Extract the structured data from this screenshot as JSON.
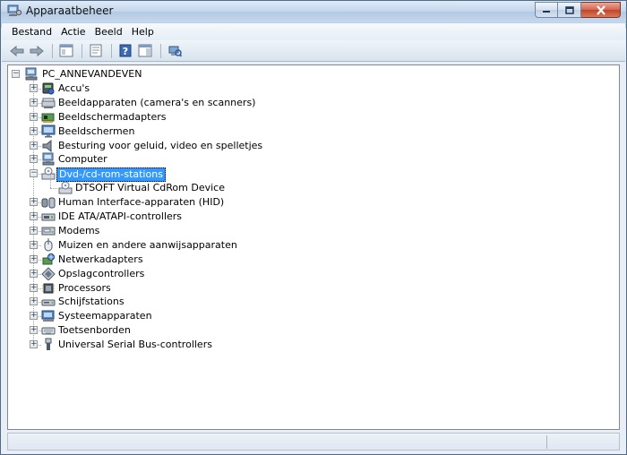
{
  "window": {
    "title": "Apparaatbeheer"
  },
  "menubar": {
    "items": [
      {
        "label": "Bestand"
      },
      {
        "label": "Actie"
      },
      {
        "label": "Beeld"
      },
      {
        "label": "Help"
      }
    ]
  },
  "toolbar": {
    "buttons": [
      {
        "icon": "back-arrow-icon"
      },
      {
        "icon": "forward-arrow-icon"
      },
      {
        "icon": "console-tree-icon"
      },
      {
        "icon": "properties-icon"
      },
      {
        "icon": "help-icon"
      },
      {
        "icon": "action-pane-icon"
      },
      {
        "icon": "scan-hardware-icon"
      }
    ]
  },
  "tree": {
    "root": {
      "label": "PC_ANNEVANDEVEN",
      "icon": "computer-icon"
    },
    "categories": [
      {
        "label": "Accu's",
        "icon": "battery-icon"
      },
      {
        "label": "Beeldapparaten (camera's en scanners)",
        "icon": "camera-scanner-icon"
      },
      {
        "label": "Beeldschermadapters",
        "icon": "display-adapter-icon"
      },
      {
        "label": "Beeldschermen",
        "icon": "monitor-icon"
      },
      {
        "label": "Besturing voor geluid, video en spelletjes",
        "icon": "speaker-icon"
      },
      {
        "label": "Computer",
        "icon": "computer-icon"
      },
      {
        "label": "Dvd-/cd-rom-stations",
        "icon": "dvd-drive-icon",
        "expanded": true,
        "selected": true,
        "children": [
          {
            "label": "DTSOFT Virtual CdRom Device",
            "icon": "dvd-drive-icon"
          }
        ]
      },
      {
        "label": "Human Interface-apparaten (HID)",
        "icon": "hid-icon"
      },
      {
        "label": "IDE ATA/ATAPI-controllers",
        "icon": "ide-controller-icon"
      },
      {
        "label": "Modems",
        "icon": "modem-icon"
      },
      {
        "label": "Muizen en andere aanwijsapparaten",
        "icon": "mouse-icon"
      },
      {
        "label": "Netwerkadapters",
        "icon": "network-adapter-icon"
      },
      {
        "label": "Opslagcontrollers",
        "icon": "storage-controller-icon"
      },
      {
        "label": "Processors",
        "icon": "processor-icon"
      },
      {
        "label": "Schijfstations",
        "icon": "disk-drive-icon"
      },
      {
        "label": "Systeemapparaten",
        "icon": "system-device-icon"
      },
      {
        "label": "Toetsenborden",
        "icon": "keyboard-icon"
      },
      {
        "label": "Universal Serial Bus-controllers",
        "icon": "usb-icon"
      }
    ]
  }
}
